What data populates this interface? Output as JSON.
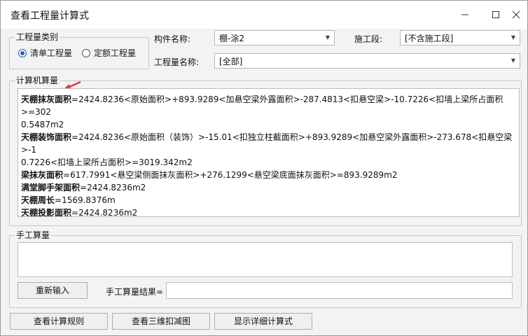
{
  "window": {
    "title": "查看工程量计算式"
  },
  "category_group": {
    "label": "工程量类别",
    "options": [
      {
        "label": "清单工程量",
        "selected": true
      },
      {
        "label": "定额工程量",
        "selected": false
      }
    ]
  },
  "fields": {
    "component_label": "构件名称:",
    "component_value": "棚-涂2",
    "construction_label": "施工段:",
    "construction_value": "[不含施工段]",
    "quantity_label": "工程量名称:",
    "quantity_value": "[全部]"
  },
  "computer_calc": {
    "label": "计算机算量",
    "lines": [
      {
        "name": "天棚抹灰面积",
        "expr": "=2424.8236<原始面积>+893.9289<加悬空梁外露面积>-287.4813<扣悬空梁>-10.7226<扣墙上梁所占面积>=302"
      },
      {
        "name": "",
        "expr": "0.5487m2"
      },
      {
        "name": "天棚装饰面积",
        "expr": "=2424.8236<原始面积（装饰）>-15.01<扣独立柱截面积>+893.9289<加悬空梁外露面积>-273.678<扣悬空梁>-1"
      },
      {
        "name": "",
        "expr": "0.7226<扣墙上梁所占面积>=3019.342m2"
      },
      {
        "name": "梁抹灰面积",
        "expr": "=617.7991<悬空梁侧面抹灰面积>+276.1299<悬空梁底面抹灰面积>=893.9289m2"
      },
      {
        "name": "满堂脚手架面积",
        "expr": "=2424.8236m2"
      },
      {
        "name": "天棚周长",
        "expr": "=1569.8376m"
      },
      {
        "name": "天棚投影面积",
        "expr": "=2424.8236m2"
      }
    ]
  },
  "manual_calc": {
    "label": "手工算量",
    "reenter_button": "重新输入",
    "result_label": "手工算量结果=",
    "result_value": ""
  },
  "bottom_buttons": {
    "view_rules": "查看计算规则",
    "view_3d": "查看三维扣减图",
    "show_detail": "显示详细计算式"
  },
  "colors": {
    "accent": "#2a5fb0",
    "annotation_arrow": "#e53935"
  }
}
